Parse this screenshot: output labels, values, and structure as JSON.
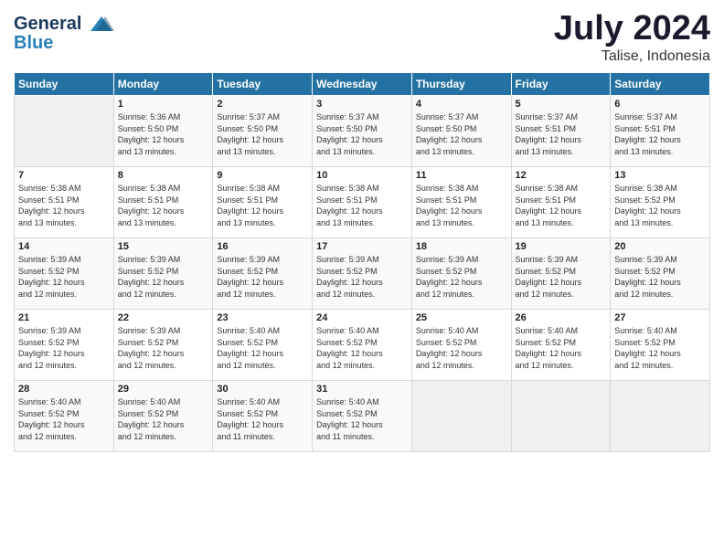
{
  "header": {
    "logo_line1": "General",
    "logo_line2": "Blue",
    "month": "July 2024",
    "location": "Talise, Indonesia"
  },
  "days_of_week": [
    "Sunday",
    "Monday",
    "Tuesday",
    "Wednesday",
    "Thursday",
    "Friday",
    "Saturday"
  ],
  "weeks": [
    [
      {
        "day": "",
        "info": ""
      },
      {
        "day": "1",
        "info": "Sunrise: 5:36 AM\nSunset: 5:50 PM\nDaylight: 12 hours\nand 13 minutes."
      },
      {
        "day": "2",
        "info": "Sunrise: 5:37 AM\nSunset: 5:50 PM\nDaylight: 12 hours\nand 13 minutes."
      },
      {
        "day": "3",
        "info": "Sunrise: 5:37 AM\nSunset: 5:50 PM\nDaylight: 12 hours\nand 13 minutes."
      },
      {
        "day": "4",
        "info": "Sunrise: 5:37 AM\nSunset: 5:50 PM\nDaylight: 12 hours\nand 13 minutes."
      },
      {
        "day": "5",
        "info": "Sunrise: 5:37 AM\nSunset: 5:51 PM\nDaylight: 12 hours\nand 13 minutes."
      },
      {
        "day": "6",
        "info": "Sunrise: 5:37 AM\nSunset: 5:51 PM\nDaylight: 12 hours\nand 13 minutes."
      }
    ],
    [
      {
        "day": "7",
        "info": "Sunrise: 5:38 AM\nSunset: 5:51 PM\nDaylight: 12 hours\nand 13 minutes."
      },
      {
        "day": "8",
        "info": "Sunrise: 5:38 AM\nSunset: 5:51 PM\nDaylight: 12 hours\nand 13 minutes."
      },
      {
        "day": "9",
        "info": "Sunrise: 5:38 AM\nSunset: 5:51 PM\nDaylight: 12 hours\nand 13 minutes."
      },
      {
        "day": "10",
        "info": "Sunrise: 5:38 AM\nSunset: 5:51 PM\nDaylight: 12 hours\nand 13 minutes."
      },
      {
        "day": "11",
        "info": "Sunrise: 5:38 AM\nSunset: 5:51 PM\nDaylight: 12 hours\nand 13 minutes."
      },
      {
        "day": "12",
        "info": "Sunrise: 5:38 AM\nSunset: 5:51 PM\nDaylight: 12 hours\nand 13 minutes."
      },
      {
        "day": "13",
        "info": "Sunrise: 5:38 AM\nSunset: 5:52 PM\nDaylight: 12 hours\nand 13 minutes."
      }
    ],
    [
      {
        "day": "14",
        "info": "Sunrise: 5:39 AM\nSunset: 5:52 PM\nDaylight: 12 hours\nand 12 minutes."
      },
      {
        "day": "15",
        "info": "Sunrise: 5:39 AM\nSunset: 5:52 PM\nDaylight: 12 hours\nand 12 minutes."
      },
      {
        "day": "16",
        "info": "Sunrise: 5:39 AM\nSunset: 5:52 PM\nDaylight: 12 hours\nand 12 minutes."
      },
      {
        "day": "17",
        "info": "Sunrise: 5:39 AM\nSunset: 5:52 PM\nDaylight: 12 hours\nand 12 minutes."
      },
      {
        "day": "18",
        "info": "Sunrise: 5:39 AM\nSunset: 5:52 PM\nDaylight: 12 hours\nand 12 minutes."
      },
      {
        "day": "19",
        "info": "Sunrise: 5:39 AM\nSunset: 5:52 PM\nDaylight: 12 hours\nand 12 minutes."
      },
      {
        "day": "20",
        "info": "Sunrise: 5:39 AM\nSunset: 5:52 PM\nDaylight: 12 hours\nand 12 minutes."
      }
    ],
    [
      {
        "day": "21",
        "info": "Sunrise: 5:39 AM\nSunset: 5:52 PM\nDaylight: 12 hours\nand 12 minutes."
      },
      {
        "day": "22",
        "info": "Sunrise: 5:39 AM\nSunset: 5:52 PM\nDaylight: 12 hours\nand 12 minutes."
      },
      {
        "day": "23",
        "info": "Sunrise: 5:40 AM\nSunset: 5:52 PM\nDaylight: 12 hours\nand 12 minutes."
      },
      {
        "day": "24",
        "info": "Sunrise: 5:40 AM\nSunset: 5:52 PM\nDaylight: 12 hours\nand 12 minutes."
      },
      {
        "day": "25",
        "info": "Sunrise: 5:40 AM\nSunset: 5:52 PM\nDaylight: 12 hours\nand 12 minutes."
      },
      {
        "day": "26",
        "info": "Sunrise: 5:40 AM\nSunset: 5:52 PM\nDaylight: 12 hours\nand 12 minutes."
      },
      {
        "day": "27",
        "info": "Sunrise: 5:40 AM\nSunset: 5:52 PM\nDaylight: 12 hours\nand 12 minutes."
      }
    ],
    [
      {
        "day": "28",
        "info": "Sunrise: 5:40 AM\nSunset: 5:52 PM\nDaylight: 12 hours\nand 12 minutes."
      },
      {
        "day": "29",
        "info": "Sunrise: 5:40 AM\nSunset: 5:52 PM\nDaylight: 12 hours\nand 12 minutes."
      },
      {
        "day": "30",
        "info": "Sunrise: 5:40 AM\nSunset: 5:52 PM\nDaylight: 12 hours\nand 11 minutes."
      },
      {
        "day": "31",
        "info": "Sunrise: 5:40 AM\nSunset: 5:52 PM\nDaylight: 12 hours\nand 11 minutes."
      },
      {
        "day": "",
        "info": ""
      },
      {
        "day": "",
        "info": ""
      },
      {
        "day": "",
        "info": ""
      }
    ]
  ]
}
